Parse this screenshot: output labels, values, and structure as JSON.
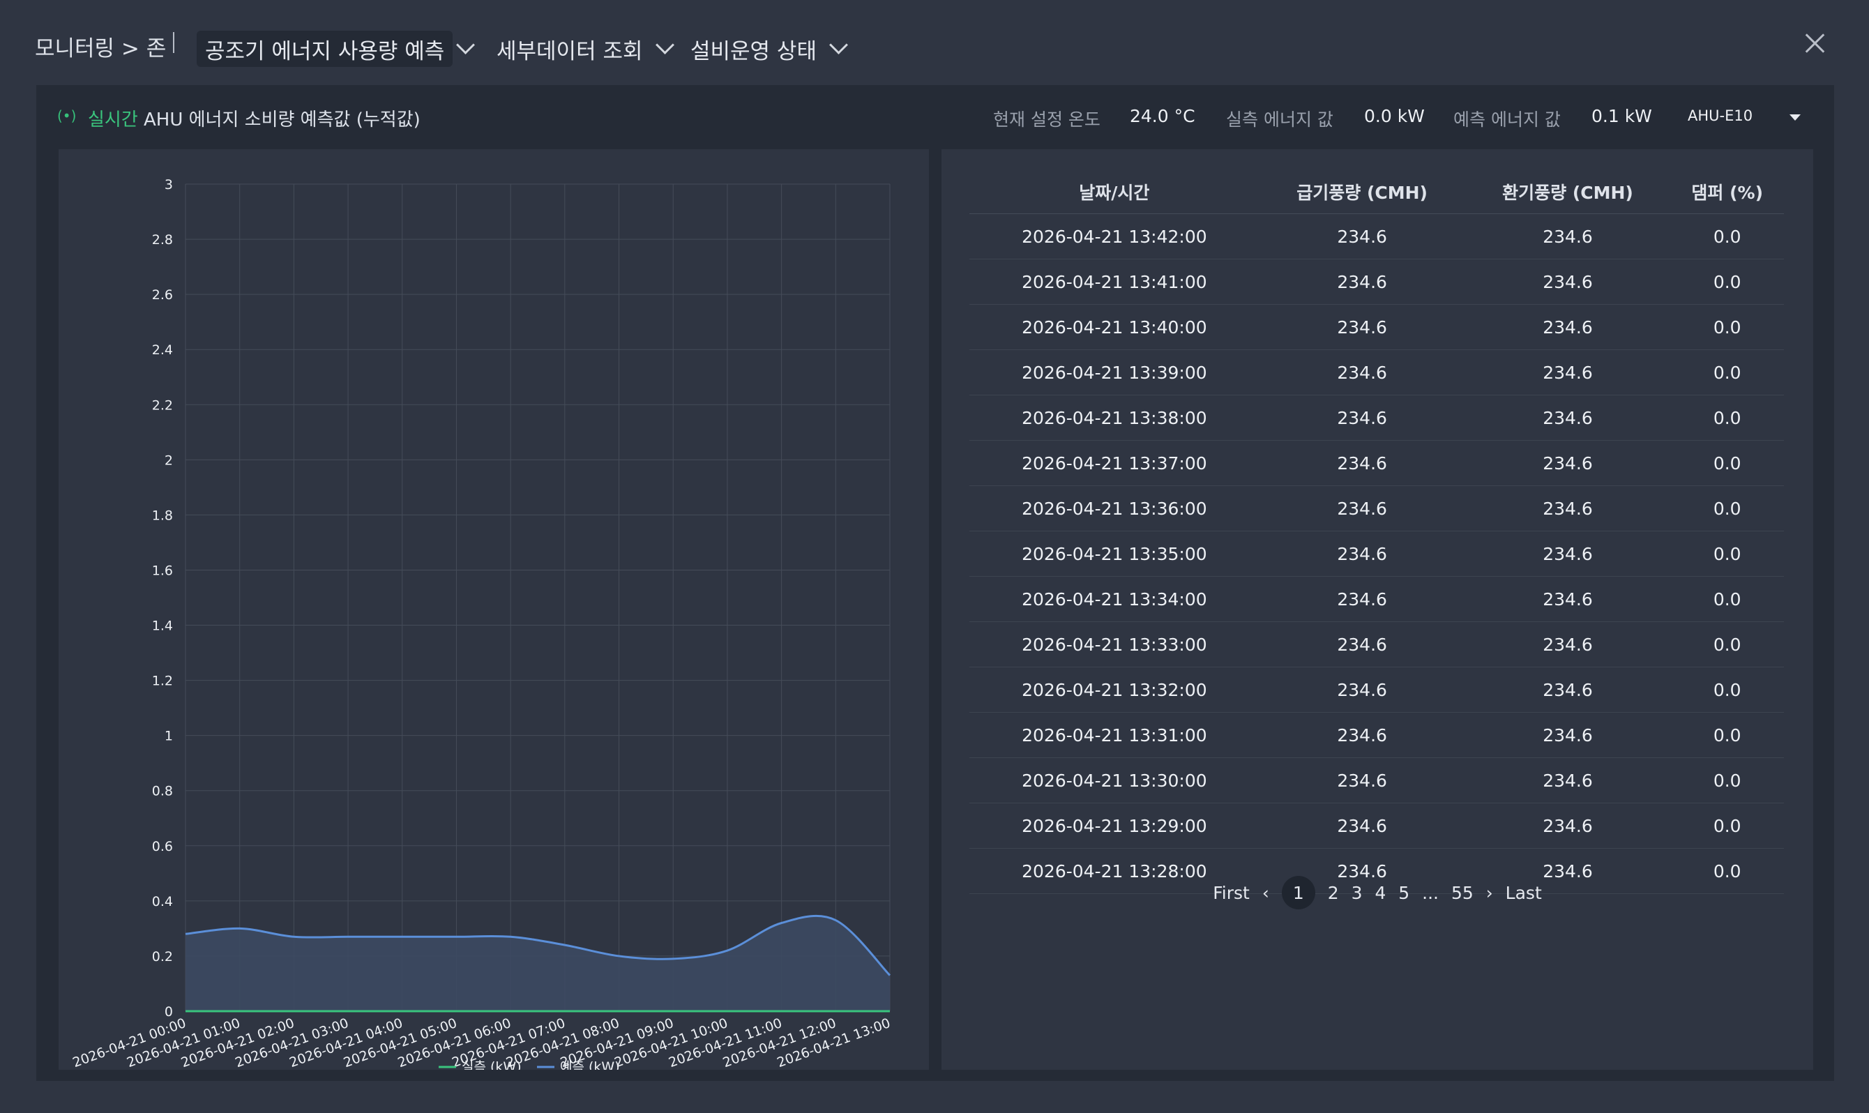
{
  "topbar": {
    "breadcrumb": "모니터링 > 존",
    "tabs": [
      {
        "label": "공조기 에너지 사용량 예측"
      },
      {
        "label": "세부데이터 조회"
      },
      {
        "label": "설비운영 상태"
      }
    ]
  },
  "header": {
    "live_label": "실시간",
    "title": "AHU 에너지 소비량 예측값 (누적값)",
    "set_temp_label": "현재 설정 온도",
    "set_temp_value": "24.0 °C",
    "actual_label": "실측 에너지 값",
    "actual_value": "0.0 kW",
    "pred_label": "예측 에너지 값",
    "pred_value": "0.1 kW",
    "unit_select": "AHU-E10"
  },
  "colors": {
    "actual": "#3ac47d",
    "pred": "#5b8fd9",
    "bg": "#2f3542",
    "panel": "#252b36"
  },
  "chart_data": {
    "type": "area",
    "x": [
      "2026-04-21 00:00",
      "2026-04-21 01:00",
      "2026-04-21 02:00",
      "2026-04-21 03:00",
      "2026-04-21 04:00",
      "2026-04-21 05:00",
      "2026-04-21 06:00",
      "2026-04-21 07:00",
      "2026-04-21 08:00",
      "2026-04-21 09:00",
      "2026-04-21 10:00",
      "2026-04-21 11:00",
      "2026-04-21 12:00",
      "2026-04-21 13:00"
    ],
    "series": [
      {
        "name": "실측 (kW)",
        "values": [
          0,
          0,
          0,
          0,
          0,
          0,
          0,
          0,
          0,
          0,
          0,
          0,
          0,
          0
        ]
      },
      {
        "name": "예측 (kW)",
        "values": [
          0.28,
          0.3,
          0.27,
          0.27,
          0.27,
          0.27,
          0.27,
          0.24,
          0.2,
          0.19,
          0.22,
          0.32,
          0.33,
          0.13
        ]
      }
    ],
    "yticks": [
      "0",
      "0.2",
      "0.4",
      "0.6",
      "0.8",
      "1",
      "1.2",
      "1.4",
      "1.6",
      "1.8",
      "2",
      "2.2",
      "2.4",
      "2.6",
      "2.8",
      "3"
    ],
    "ylim": [
      0,
      3
    ],
    "grid": true,
    "legend": "bottom"
  },
  "table": {
    "headers": [
      "날짜/시간",
      "급기풍량 (CMH)",
      "환기풍량 (CMH)",
      "댐퍼 (%)"
    ],
    "rows": [
      [
        "2026-04-21 13:42:00",
        "234.6",
        "234.6",
        "0.0"
      ],
      [
        "2026-04-21 13:41:00",
        "234.6",
        "234.6",
        "0.0"
      ],
      [
        "2026-04-21 13:40:00",
        "234.6",
        "234.6",
        "0.0"
      ],
      [
        "2026-04-21 13:39:00",
        "234.6",
        "234.6",
        "0.0"
      ],
      [
        "2026-04-21 13:38:00",
        "234.6",
        "234.6",
        "0.0"
      ],
      [
        "2026-04-21 13:37:00",
        "234.6",
        "234.6",
        "0.0"
      ],
      [
        "2026-04-21 13:36:00",
        "234.6",
        "234.6",
        "0.0"
      ],
      [
        "2026-04-21 13:35:00",
        "234.6",
        "234.6",
        "0.0"
      ],
      [
        "2026-04-21 13:34:00",
        "234.6",
        "234.6",
        "0.0"
      ],
      [
        "2026-04-21 13:33:00",
        "234.6",
        "234.6",
        "0.0"
      ],
      [
        "2026-04-21 13:32:00",
        "234.6",
        "234.6",
        "0.0"
      ],
      [
        "2026-04-21 13:31:00",
        "234.6",
        "234.6",
        "0.0"
      ],
      [
        "2026-04-21 13:30:00",
        "234.6",
        "234.6",
        "0.0"
      ],
      [
        "2026-04-21 13:29:00",
        "234.6",
        "234.6",
        "0.0"
      ],
      [
        "2026-04-21 13:28:00",
        "234.6",
        "234.6",
        "0.0"
      ]
    ]
  },
  "pager": {
    "first": "First",
    "prev": "‹",
    "pages": [
      "1",
      "2",
      "3",
      "4",
      "5"
    ],
    "ellipsis": "...",
    "last_page": "55",
    "next": "›",
    "last": "Last",
    "current": "1"
  }
}
